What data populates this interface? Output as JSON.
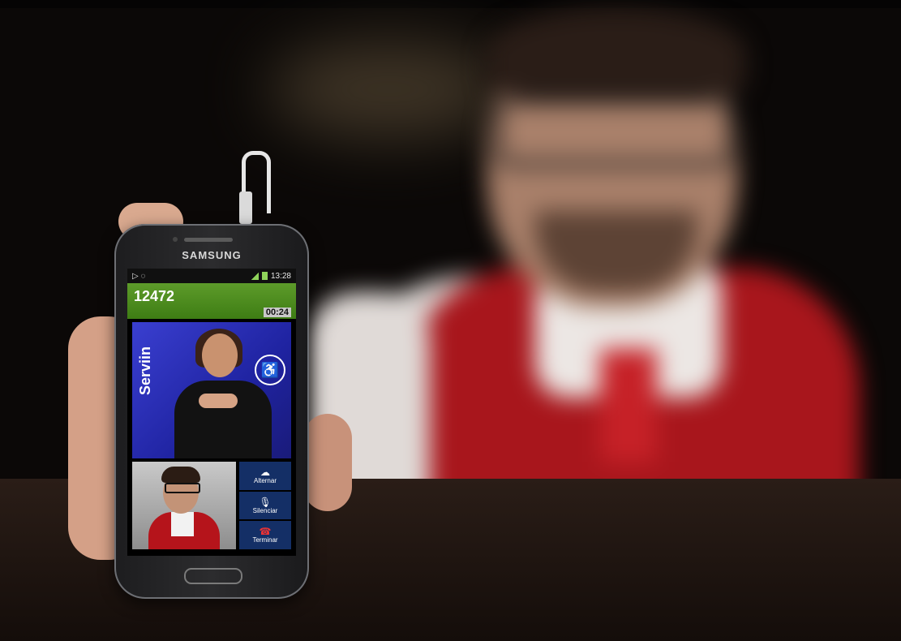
{
  "phone": {
    "brand": "SAMSUNG",
    "status_time": "13:28",
    "call_number": "12472",
    "call_timer": "00:24",
    "service_label": "Serviin",
    "buttons": {
      "alternar": "Alternar",
      "silenciar": "Silenciar",
      "terminar": "Terminar"
    }
  },
  "icons": [
    "accessibility-icon",
    "camera-switch-icon",
    "microphone-icon",
    "end-call-icon",
    "signal-icon",
    "battery-icon"
  ],
  "colors": {
    "call_bar": "#4e8c1e",
    "video_bg": "#2a2fb8",
    "button_bg": "#142f66",
    "vest": "#b5141b"
  }
}
